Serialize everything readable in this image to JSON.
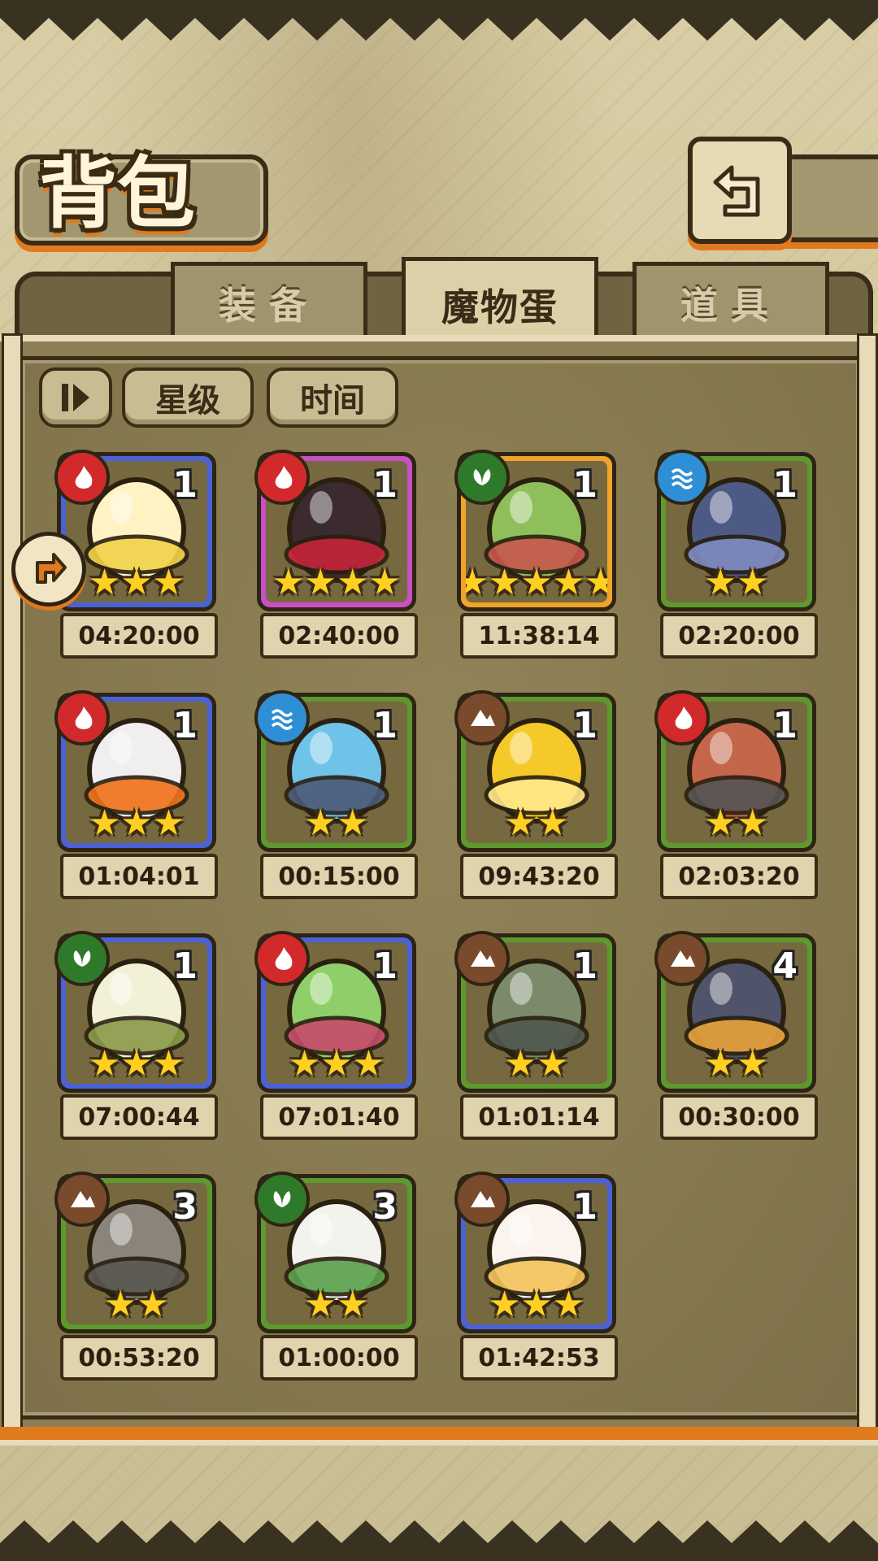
{
  "header": {
    "title": "背包",
    "back_icon": "back-arrow-icon"
  },
  "tabs": [
    {
      "label": "装备",
      "active": false
    },
    {
      "label": "魔物蛋",
      "active": true
    },
    {
      "label": "道具",
      "active": false
    }
  ],
  "filters": {
    "sort_icon": "sort-toggle-icon",
    "star_label": "星级",
    "time_label": "时间"
  },
  "colors": {
    "accent": "#e07a1c",
    "frame": "#3a2c16",
    "panel": "#8c7f55"
  },
  "eggs": [
    {
      "element": "fire",
      "border": "#4a62d6",
      "count": "1",
      "stars": "★★★",
      "timer": "04:20:00",
      "art": "lightning-egg"
    },
    {
      "element": "fire",
      "border": "#c84fc4",
      "count": "1",
      "stars": "★★★★",
      "timer": "02:40:00",
      "art": "dark-fire-egg"
    },
    {
      "element": "leaf",
      "border": "#f0a42a",
      "count": "1",
      "stars": "★★★★★",
      "timer": "11:38:14",
      "art": "green-scarf-egg"
    },
    {
      "element": "water",
      "border": "#5d9a2e",
      "count": "1",
      "stars": "★★",
      "timer": "02:20:00",
      "art": "shell-egg"
    },
    {
      "element": "fire",
      "border": "#4a62d6",
      "count": "1",
      "stars": "★★★",
      "timer": "01:04:01",
      "art": "flame-scorpion-egg"
    },
    {
      "element": "water",
      "border": "#5d9a2e",
      "count": "1",
      "stars": "★★",
      "timer": "00:15:00",
      "art": "spiral-shell-egg"
    },
    {
      "element": "earth",
      "border": "#5d9a2e",
      "count": "1",
      "stars": "★★",
      "timer": "09:43:20",
      "art": "golden-slime-egg"
    },
    {
      "element": "fire",
      "border": "#5d9a2e",
      "count": "1",
      "stars": "★★",
      "timer": "02:03:20",
      "art": "lava-rock-egg"
    },
    {
      "element": "leaf",
      "border": "#4a62d6",
      "count": "1",
      "stars": "★★★",
      "timer": "07:00:44",
      "art": "flower-bud-egg"
    },
    {
      "element": "fire",
      "border": "#4a62d6",
      "count": "1",
      "stars": "★★★",
      "timer": "07:01:40",
      "art": "cabbage-plant-egg"
    },
    {
      "element": "earth",
      "border": "#5d9a2e",
      "count": "1",
      "stars": "★★",
      "timer": "01:01:14",
      "art": "mussel-egg"
    },
    {
      "element": "earth",
      "border": "#5d9a2e",
      "count": "4",
      "stars": "★★",
      "timer": "00:30:00",
      "art": "hat-rock-egg"
    },
    {
      "element": "earth",
      "border": "#5d9a2e",
      "count": "3",
      "stars": "★★",
      "timer": "00:53:20",
      "art": "stone-golem-egg"
    },
    {
      "element": "leaf",
      "border": "#5d9a2e",
      "count": "3",
      "stars": "★★",
      "timer": "01:00:00",
      "art": "radish-egg"
    },
    {
      "element": "earth",
      "border": "#4a62d6",
      "count": "1",
      "stars": "★★★",
      "timer": "01:42:53",
      "art": "fluffy-moth-egg"
    }
  ]
}
